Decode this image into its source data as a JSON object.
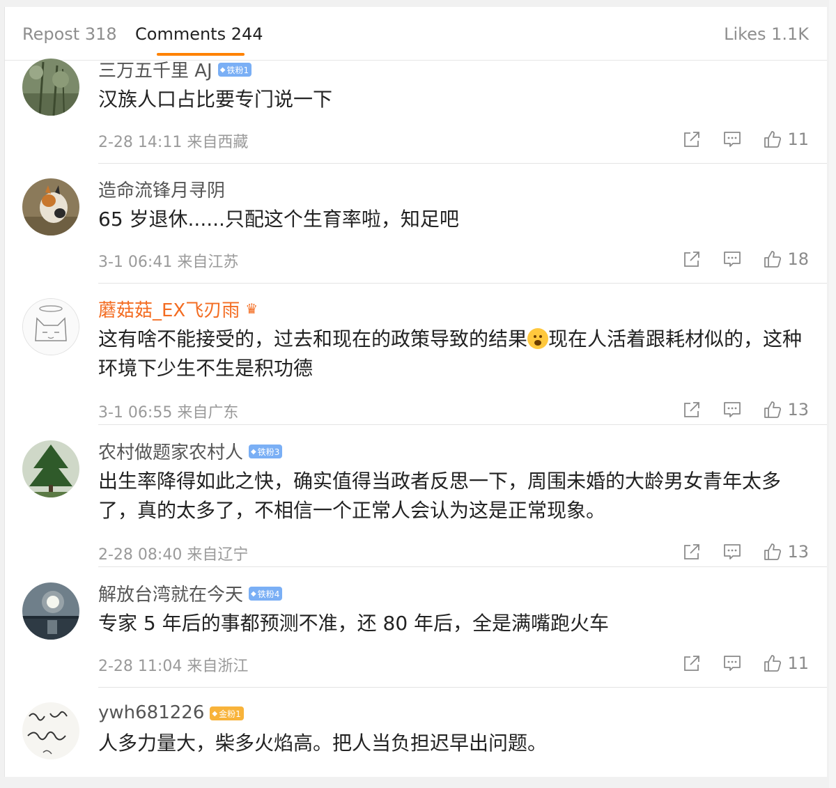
{
  "tabs": {
    "repost": "Repost 318",
    "comments": "Comments 244",
    "likes": "Likes 1.1K"
  },
  "colors": {
    "accent": "#ff8200",
    "vip_name": "#f36c21",
    "badge_iron": "#7aaff5",
    "badge_gold": "#f8b33a"
  },
  "comments": [
    {
      "username": "三万五千里 AJ",
      "badge": "铁粉1",
      "text": "汉族人口占比要专门说一下",
      "time": "2-28 14:11",
      "location": "来自西藏",
      "likes": "11"
    },
    {
      "username": "造命流锋月寻阴",
      "text": "65 岁退休......只配这个生育率啦，知足吧",
      "time": "3-1 06:41",
      "location": "来自江苏",
      "likes": "18"
    },
    {
      "username": "蘑菇菇_EX飞刃雨",
      "text_before": "这有啥不能接受的，过去和现在的政策导致的结果",
      "emoji": "crying-face",
      "text_after": "现在人活着跟耗材似的，这种环境下少生不生是积功德",
      "time": "3-1 06:55",
      "location": "来自广东",
      "likes": "13"
    },
    {
      "username": "农村做题家农村人",
      "badge": "铁粉3",
      "text": "出生率降得如此之快，确实值得当政者反思一下，周围未婚的大龄男女青年太多了，真的太多了，不相信一个正常人会认为这是正常现象。",
      "time": "2-28 08:40",
      "location": "来自辽宁",
      "likes": "13"
    },
    {
      "username": "解放台湾就在今天",
      "badge": "铁粉4",
      "text": "专家 5 年后的事都预测不准，还 80 年后，全是满嘴跑火车",
      "time": "2-28 11:04",
      "location": "来自浙江",
      "likes": "11"
    },
    {
      "username": "ywh681226",
      "badge": "金粉1",
      "text": "人多力量大，柴多火焰高。把人当负担迟早出问题。"
    }
  ]
}
